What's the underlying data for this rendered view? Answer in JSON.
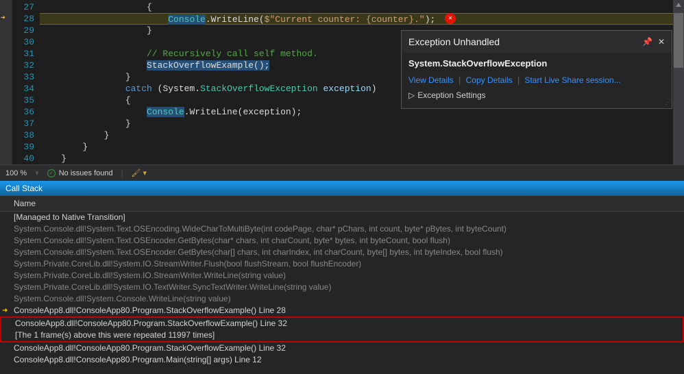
{
  "editor": {
    "lines": {
      "27": "27",
      "28": "28",
      "29": "29",
      "30": "30",
      "31": "31",
      "32": "32",
      "33": "33",
      "34": "34",
      "35": "35",
      "36": "36",
      "37": "37",
      "38": "38",
      "39": "39",
      "40": "40"
    },
    "code": {
      "l27_brace": "{",
      "l28_console": "Console",
      "l28_writeline": ".WriteLine(",
      "l28_str": "$\"Current counter: {counter}.\"",
      "l28_end": ");",
      "l29_brace": "}",
      "l31_comment": "// Recursively call self method.",
      "l32_call": "StackOverflowExample();",
      "l33_brace": "}",
      "l34_catch": "catch",
      "l34_paren": " (System.",
      "l34_type": "StackOverflowException",
      "l34_var": " exception",
      "l34_end": ")",
      "l35_brace": "{",
      "l36_console": "Console",
      "l36_writeline": ".WriteLine(exception);",
      "l37_brace": "}",
      "l38_brace": "}",
      "l39_brace": "}",
      "l40_brace": "}"
    }
  },
  "exception": {
    "title": "Exception Unhandled",
    "name": "System.StackOverflowException",
    "links": {
      "view_details": "View Details",
      "copy_details": "Copy Details",
      "live_share": "Start Live Share session..."
    },
    "settings": "Exception Settings",
    "error_glyph": "✕"
  },
  "status": {
    "zoom": "100 %",
    "issues": "No issues found"
  },
  "callstack": {
    "title": "Call Stack",
    "header": "Name",
    "rows": [
      "[Managed to Native Transition]",
      "System.Console.dll!System.Text.OSEncoding.WideCharToMultiByte(int codePage, char* pChars, int count, byte* pBytes, int byteCount)",
      "System.Console.dll!System.Text.OSEncoder.GetBytes(char* chars, int charCount, byte* bytes, int byteCount, bool flush)",
      "System.Console.dll!System.Text.OSEncoder.GetBytes(char[] chars, int charIndex, int charCount, byte[] bytes, int byteIndex, bool flush)",
      "System.Private.CoreLib.dll!System.IO.StreamWriter.Flush(bool flushStream, bool flushEncoder)",
      "System.Private.CoreLib.dll!System.IO.StreamWriter.WriteLine(string value)",
      "System.Private.CoreLib.dll!System.IO.TextWriter.SyncTextWriter.WriteLine(string value)",
      "System.Console.dll!System.Console.WriteLine(string value)",
      "ConsoleApp8.dll!ConsoleApp80.Program.StackOverflowExample() Line 28",
      "ConsoleApp8.dll!ConsoleApp80.Program.StackOverflowExample() Line 32",
      "[The 1 frame(s) above this were repeated 11997 times]",
      "ConsoleApp8.dll!ConsoleApp80.Program.StackOverflowExample() Line 32",
      "ConsoleApp8.dll!ConsoleApp80.Program.Main(string[] args) Line 12"
    ]
  }
}
